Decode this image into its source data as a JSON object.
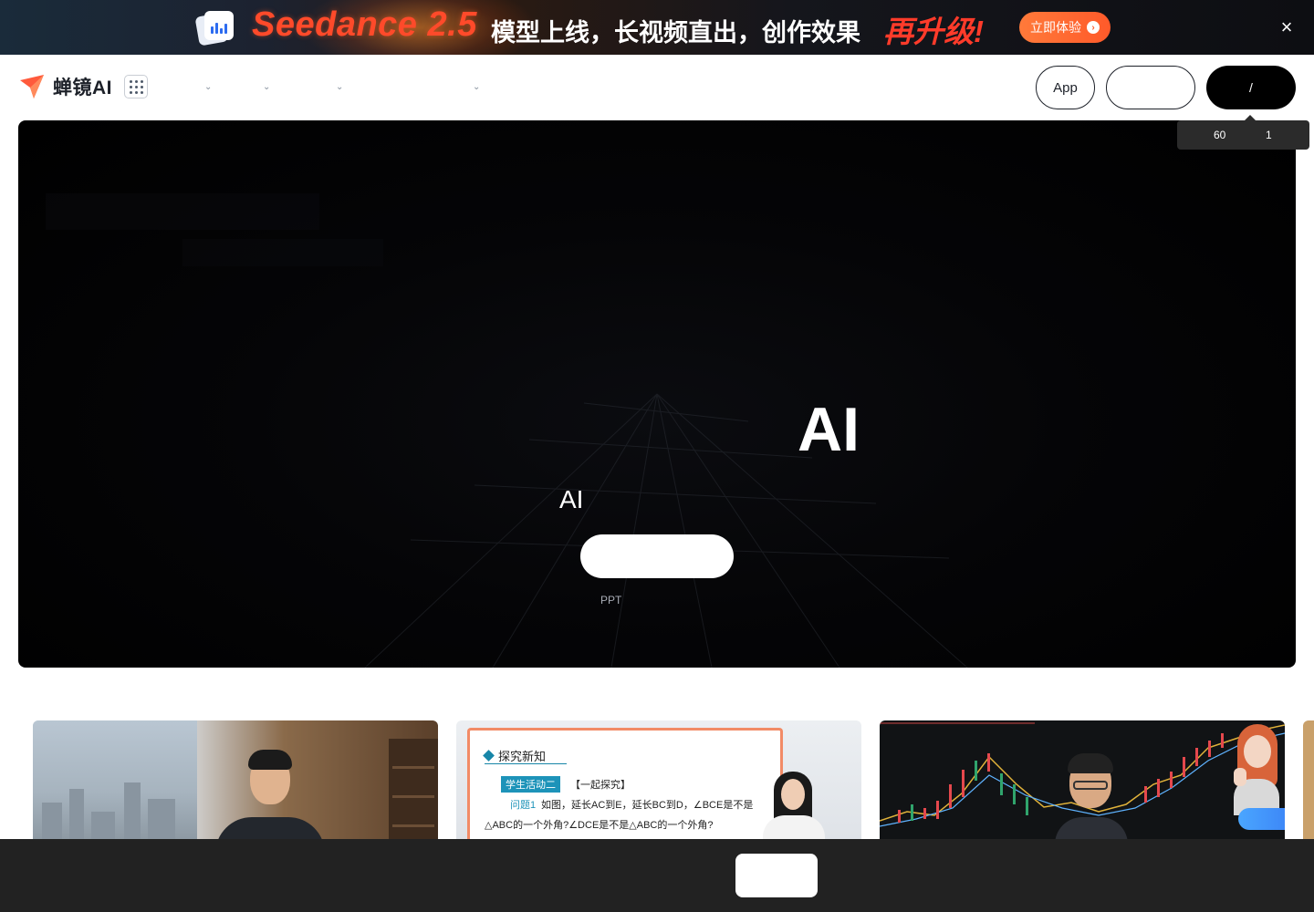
{
  "banner": {
    "title": "Seedance 2.5",
    "text": "模型上线，长视频直出，创作效果",
    "highlight": "再升级!",
    "cta_label": "立即体验",
    "close_icon": "close-icon",
    "accent_color": "#ff4a2a"
  },
  "nav": {
    "brand_name": "蝉镜AI",
    "brand_color": "#ff5a3c",
    "apps_icon": "grid-icon",
    "menu_items": [
      {
        "label": "",
        "icon": "chevron-down-icon"
      },
      {
        "label": "",
        "icon": "chevron-down-icon"
      },
      {
        "label": "",
        "icon": "chevron-down-icon"
      },
      {
        "label": "",
        "icon": "chevron-down-icon"
      }
    ],
    "app_button": "App",
    "outline_button": "",
    "dark_button": "/",
    "tooltip": {
      "left": "60",
      "right": "1"
    }
  },
  "hero": {
    "title": "AI",
    "subtitle": "AI",
    "cta_label": "",
    "note": "PPT"
  },
  "cards": {
    "card2": {
      "heading": "探究新知",
      "tag": "学生活动二",
      "tag_note": "【一起探究】",
      "question_label": "问题1",
      "question_text": "如图，延长AC到E，延长BC到D，∠BCE是不是",
      "question_cont": "△ABC的一个外角?∠DCE是不是△ABC的一个外角?"
    }
  },
  "bottom": {
    "button_label": ""
  }
}
